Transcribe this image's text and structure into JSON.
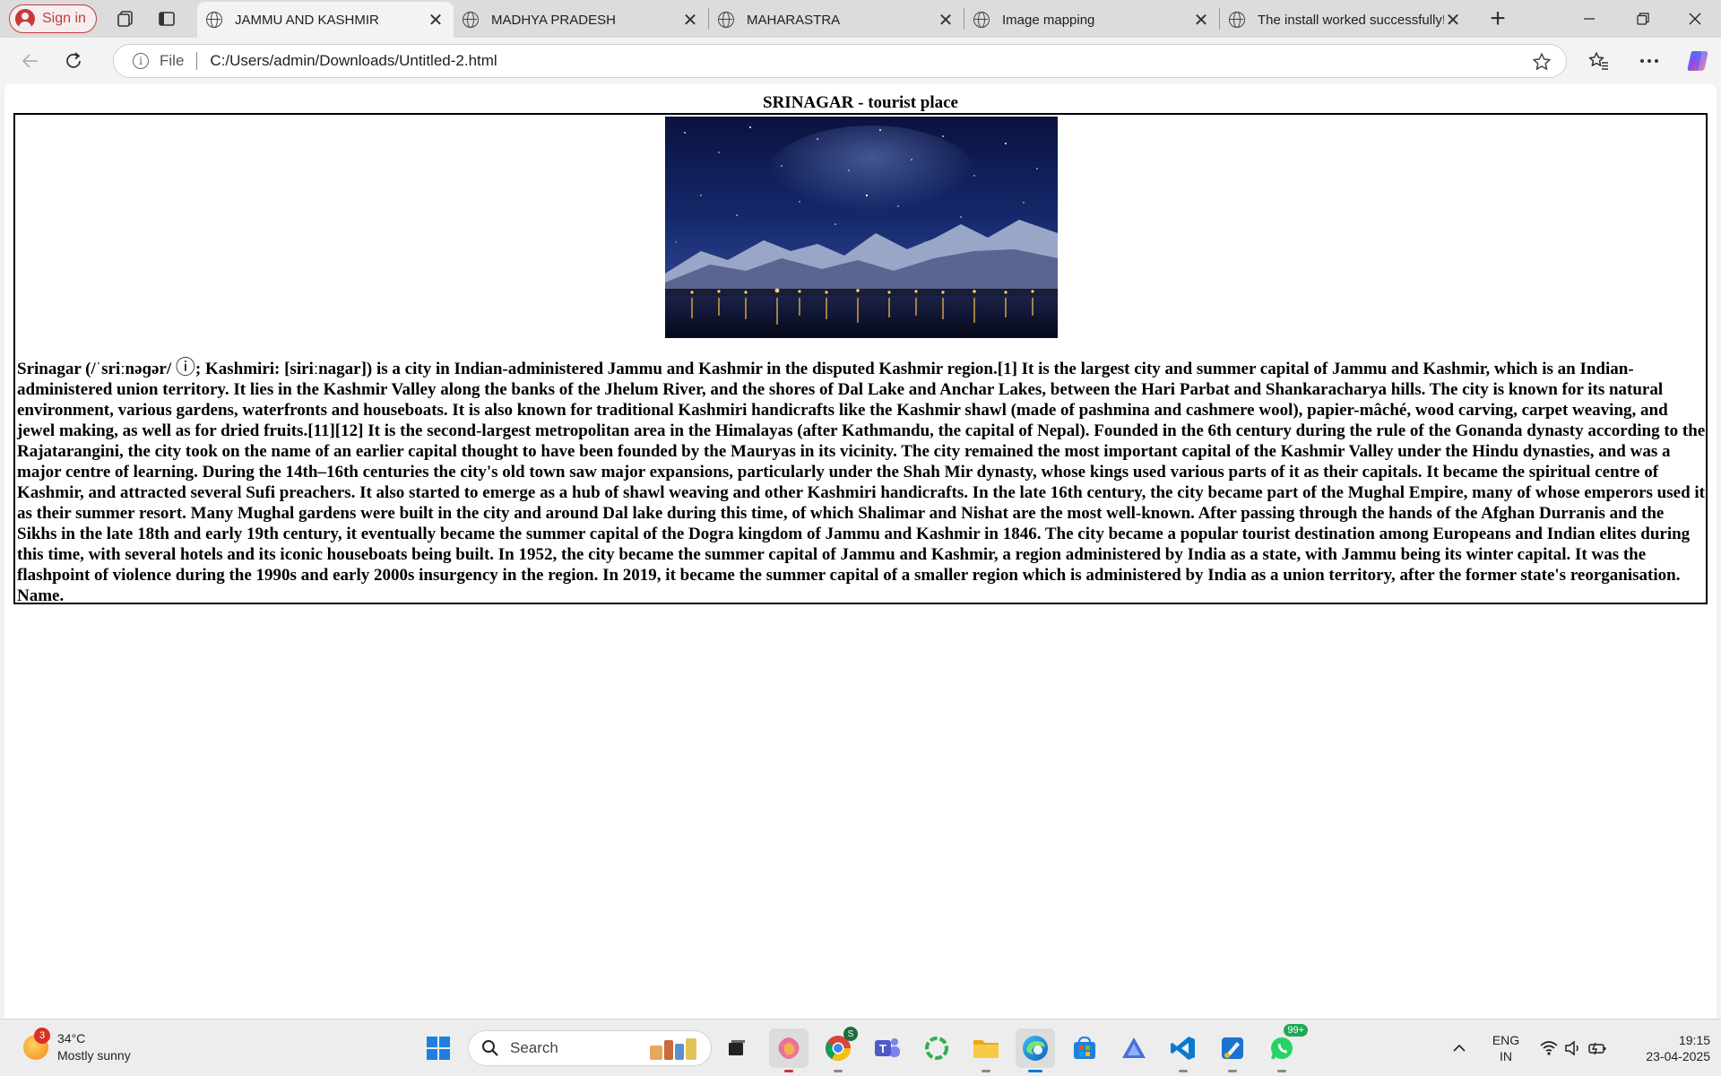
{
  "browser": {
    "profile_label": "Sign in",
    "tabs": [
      {
        "title": "JAMMU AND KASHMIR",
        "active": true
      },
      {
        "title": "MADHYA PRADESH",
        "active": false
      },
      {
        "title": "MAHARASTRA",
        "active": false
      },
      {
        "title": "Image mapping",
        "active": false
      },
      {
        "title": "The install worked successfully! Con",
        "active": false
      }
    ],
    "address": {
      "scheme_label": "File",
      "url": "C:/Users/admin/Downloads/Untitled-2.html"
    }
  },
  "page": {
    "heading": "SRINAGAR - tourist place",
    "article": {
      "lead_before_audio": "Srinagar (/ˈsriːnəɡər/ ",
      "audio_symbol": "ⓘ",
      "body": "; Kashmiri: [siriːnagar]) is a city in Indian-administered Jammu and Kashmir in the disputed Kashmir region.[1] It is the largest city and summer capital of Jammu and Kashmir, which is an Indian-administered union territory. It lies in the Kashmir Valley along the banks of the Jhelum River, and the shores of Dal Lake and Anchar Lakes, between the Hari Parbat and Shankaracharya hills. The city is known for its natural environment, various gardens, waterfronts and houseboats. It is also known for traditional Kashmiri handicrafts like the Kashmir shawl (made of pashmina and cashmere wool), papier-mâché, wood carving, carpet weaving, and jewel making, as well as for dried fruits.[11][12] It is the second-largest metropolitan area in the Himalayas (after Kathmandu, the capital of Nepal). Founded in the 6th century during the rule of the Gonanda dynasty according to the Rajatarangini, the city took on the name of an earlier capital thought to have been founded by the Mauryas in its vicinity. The city remained the most important capital of the Kashmir Valley under the Hindu dynasties, and was a major centre of learning. During the 14th–16th centuries the city's old town saw major expansions, particularly under the Shah Mir dynasty, whose kings used various parts of it as their capitals. It became the spiritual centre of Kashmir, and attracted several Sufi preachers. It also started to emerge as a hub of shawl weaving and other Kashmiri handicrafts. In the late 16th century, the city became part of the Mughal Empire, many of whose emperors used it as their summer resort. Many Mughal gardens were built in the city and around Dal lake during this time, of which Shalimar and Nishat are the most well-known. After passing through the hands of the Afghan Durranis and the Sikhs in the late 18th and early 19th century, it eventually became the summer capital of the Dogra kingdom of Jammu and Kashmir in 1846. The city became a popular tourist destination among Europeans and Indian elites during this time, with several hotels and its iconic houseboats being built. In 1952, the city became the summer capital of Jammu and Kashmir, a region administered by India as a state, with Jammu being its winter capital. It was the flashpoint of violence during the 1990s and early 2000s insurgency in the region. In 2019, it became the summer capital of a smaller region which is administered by India as a union territory, after the former state's reorganisation. Name."
    }
  },
  "taskbar": {
    "weather": {
      "badge": "3",
      "temp": "34°C",
      "condition": "Mostly sunny"
    },
    "search_label": "Search",
    "whatsapp_badge": "99+",
    "chrome_badge": "S",
    "tray": {
      "lang": "ENG",
      "region": "IN",
      "time": "19:15",
      "date": "23-04-2025"
    }
  },
  "colors": {
    "accent_blue": "#0078d4",
    "profile_red": "#c43a3a",
    "whatsapp_green": "#1ea952"
  },
  "icons": [
    "person-icon",
    "workspaces-icon",
    "tab-actions-icon",
    "globe-icon",
    "close-icon",
    "plus-icon",
    "minimize-icon",
    "restore-icon",
    "back-icon",
    "refresh-icon",
    "info-icon",
    "star-icon",
    "favorites-icon",
    "more-icon",
    "copilot-icon",
    "windows-start-icon",
    "search-icon"
  ]
}
